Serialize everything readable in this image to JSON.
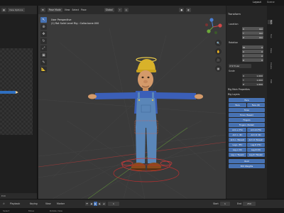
{
  "workspace": {
    "name": "Layout",
    "secondary": "Scene"
  },
  "left_editor": {
    "view_button": "View Options",
    "footer": "Edit"
  },
  "viewport": {
    "mode": "Pose Mode",
    "menus": [
      "View",
      "Select",
      "Pose"
    ],
    "transform": "Global",
    "view_name": "User Perspective",
    "context": "(1) Rot Solid Level Rig : Collar.bone.000",
    "tools": [
      "cursor",
      "move",
      "rotate",
      "scale",
      "transform",
      "annotate",
      "measure"
    ],
    "nav_buttons": [
      "zoom",
      "hand",
      "camera",
      "grid"
    ]
  },
  "properties": {
    "title": "Transform",
    "location_label": "Location",
    "location": [
      "0m",
      "0m",
      "0m"
    ],
    "rotation_label": "Rotation",
    "rotation": [
      "0",
      "0",
      "0",
      "0"
    ],
    "mode_label": "XYZ Euler",
    "scale_label": "Scale",
    "scale": [
      "1.000",
      "1.000",
      "1.000"
    ],
    "rig_main_label": "Rig Main Properties",
    "rig_layers_label": "Rig Layers",
    "layer_buttons": [
      [
        "Face"
      ],
      [
        "Face",
        "Face (D)"
      ],
      [
        "Torso"
      ],
      [
        "Torso (Tweak)"
      ],
      [
        "Fingers"
      ],
      [
        "Fingers (Detail)"
      ],
      [
        "Arm.L (FK)",
        "Arm.R (FK)"
      ],
      [
        "Arm.L (IK)",
        "Arm.R (IK)"
      ],
      [
        "Arm.L (Tweak)",
        "Arm.R (Tweak)"
      ],
      [
        "Leg.L (FK)",
        "Leg.R (FK)"
      ],
      [
        "Leg.L (IK)",
        "Leg.R (IK)"
      ],
      [
        "Leg.L (Tweak)",
        "Leg.R (Tweak)"
      ],
      [
        "Root"
      ],
      [
        "Edit Weights"
      ]
    ],
    "tabs": [
      "Item",
      "Tool",
      "View",
      "Create",
      "Edit"
    ]
  },
  "timeline": {
    "menus": [
      "Playback",
      "Keying",
      "View",
      "Marker"
    ],
    "frame": "1",
    "start_label": "Start",
    "start": "1",
    "end_label": "End",
    "end": "250"
  },
  "statusbar": {
    "left": "Select",
    "mid": "Move",
    "right": "Rotate View"
  }
}
